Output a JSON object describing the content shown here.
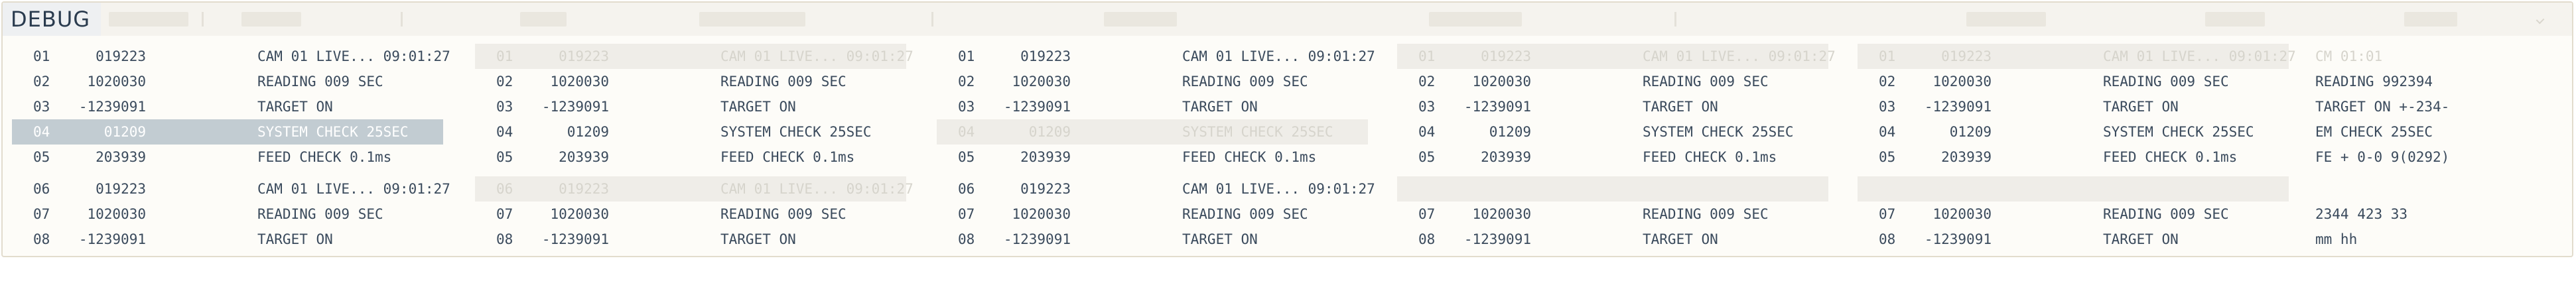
{
  "app": {
    "title": "DEBUG"
  },
  "panels": [
    {
      "rows": [
        {
          "num": "01",
          "val": "019223",
          "desc": "CAM 01 LIVE... 09:01:27",
          "state": "normal"
        },
        {
          "num": "02",
          "val": "1020030",
          "desc": "READING 009 SEC",
          "state": "normal"
        },
        {
          "num": "03",
          "val": "-1239091",
          "desc": "TARGET ON",
          "state": "normal"
        },
        {
          "num": "04",
          "val": "01209",
          "desc": "SYSTEM CHECK 25SEC",
          "state": "selected"
        },
        {
          "num": "05",
          "val": "203939",
          "desc": "FEED CHECK 0.1ms",
          "state": "normal"
        },
        {
          "num": "06",
          "val": "019223",
          "desc": "CAM 01 LIVE... 09:01:27",
          "state": "normal"
        },
        {
          "num": "07",
          "val": "1020030",
          "desc": "READING 009 SEC",
          "state": "normal"
        },
        {
          "num": "08",
          "val": "-1239091",
          "desc": "TARGET ON",
          "state": "normal"
        }
      ]
    },
    {
      "rows": [
        {
          "num": "01",
          "val": "019223",
          "desc": "CAM 01 LIVE... 09:01:27",
          "state": "faded"
        },
        {
          "num": "02",
          "val": "1020030",
          "desc": "READING 009 SEC",
          "state": "normal"
        },
        {
          "num": "03",
          "val": "-1239091",
          "desc": "TARGET ON",
          "state": "normal"
        },
        {
          "num": "04",
          "val": "01209",
          "desc": "SYSTEM CHECK 25SEC",
          "state": "normal"
        },
        {
          "num": "05",
          "val": "203939",
          "desc": "FEED CHECK 0.1ms",
          "state": "normal"
        },
        {
          "num": "06",
          "val": "019223",
          "desc": "CAM 01 LIVE... 09:01:27",
          "state": "faded"
        },
        {
          "num": "07",
          "val": "1020030",
          "desc": "READING 009 SEC",
          "state": "normal"
        },
        {
          "num": "08",
          "val": "-1239091",
          "desc": "TARGET ON",
          "state": "normal"
        }
      ]
    },
    {
      "rows": [
        {
          "num": "01",
          "val": "019223",
          "desc": "CAM 01 LIVE... 09:01:27",
          "state": "normal"
        },
        {
          "num": "02",
          "val": "1020030",
          "desc": "READING 009 SEC",
          "state": "normal"
        },
        {
          "num": "03",
          "val": "-1239091",
          "desc": "TARGET ON",
          "state": "normal"
        },
        {
          "num": "04",
          "val": "01209",
          "desc": "SYSTEM CHECK 25SEC",
          "state": "faded"
        },
        {
          "num": "05",
          "val": "203939",
          "desc": "FEED CHECK 0.1ms",
          "state": "normal"
        },
        {
          "num": "06",
          "val": "019223",
          "desc": "CAM 01 LIVE... 09:01:27",
          "state": "normal"
        },
        {
          "num": "07",
          "val": "1020030",
          "desc": "READING 009 SEC",
          "state": "normal"
        },
        {
          "num": "08",
          "val": "-1239091",
          "desc": "TARGET ON",
          "state": "normal"
        }
      ]
    },
    {
      "rows": [
        {
          "num": "01",
          "val": "019223",
          "desc": "CAM 01 LIVE... 09:01:27",
          "state": "faded"
        },
        {
          "num": "02",
          "val": "1020030",
          "desc": "READING 009 SEC",
          "state": "normal"
        },
        {
          "num": "03",
          "val": "-1239091",
          "desc": "TARGET ON",
          "state": "normal"
        },
        {
          "num": "04",
          "val": "01209",
          "desc": "SYSTEM CHECK 25SEC",
          "state": "normal"
        },
        {
          "num": "05",
          "val": "203939",
          "desc": "FEED CHECK 0.1ms",
          "state": "normal"
        },
        {
          "num": "",
          "val": "",
          "desc": "",
          "state": "blank"
        },
        {
          "num": "07",
          "val": "1020030",
          "desc": "READING 009 SEC",
          "state": "normal"
        },
        {
          "num": "08",
          "val": "-1239091",
          "desc": "TARGET ON",
          "state": "normal"
        }
      ]
    },
    {
      "rows": [
        {
          "num": "01",
          "val": "019223",
          "desc": "CAM 01 LIVE... 09:01:27",
          "extra": "CM 01:01",
          "state": "faded"
        },
        {
          "num": "02",
          "val": "1020030",
          "desc": "READING 009 SEC",
          "extra": "READING 992394",
          "state": "normal"
        },
        {
          "num": "03",
          "val": "-1239091",
          "desc": "TARGET ON",
          "extra": "TARGET ON   +-234-",
          "state": "normal"
        },
        {
          "num": "04",
          "val": "01209",
          "desc": "SYSTEM CHECK 25SEC",
          "extra": "EM CHECK 25SEC",
          "state": "normal"
        },
        {
          "num": "05",
          "val": "203939",
          "desc": "FEED CHECK 0.1ms",
          "extra": "FE + 0-0 9(0292)",
          "state": "normal"
        },
        {
          "num": "",
          "val": "",
          "desc": "",
          "extra": "",
          "state": "blank"
        },
        {
          "num": "07",
          "val": "1020030",
          "desc": "READING 009 SEC",
          "extra": "2344  423  33",
          "state": "normal"
        },
        {
          "num": "08",
          "val": "-1239091",
          "desc": "TARGET ON",
          "extra": "mm hh",
          "state": "normal"
        }
      ]
    }
  ]
}
